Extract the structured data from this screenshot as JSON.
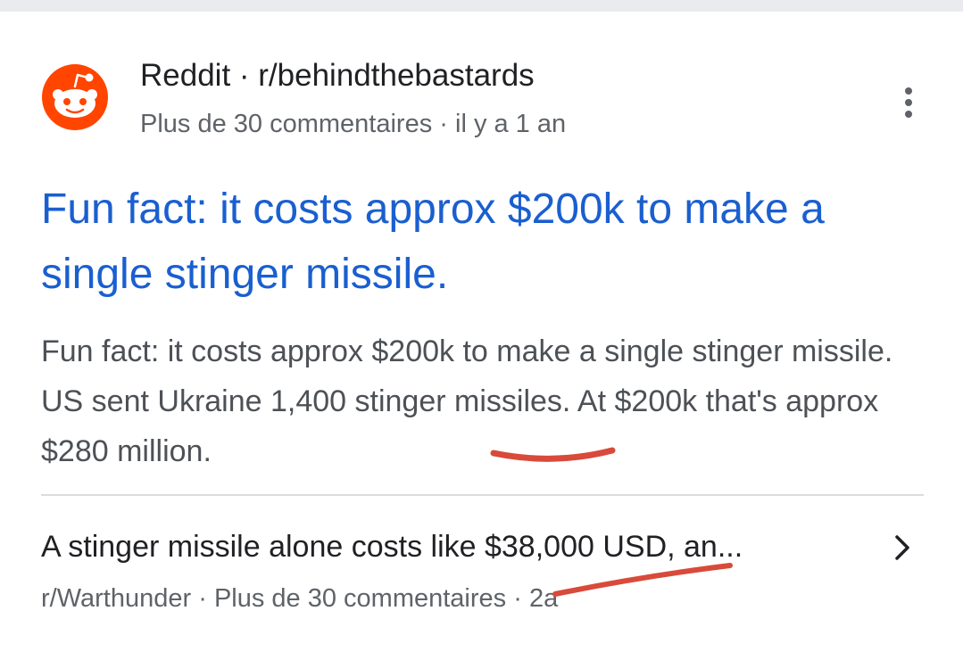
{
  "result": {
    "site_name": "Reddit",
    "separator": " · ",
    "subreddit": "r/behindthebastards",
    "comments": "Plus de 30 commentaires",
    "age": "il y a 1 an",
    "title": "Fun fact: it costs approx $200k to make a single stinger missile.",
    "snippet": "Fun fact: it costs approx $200k to make a single stinger missile. US sent Ukraine 1,400 stinger missiles. At $200k that's approx $280 million.",
    "logo_icon": "reddit-snoo-icon",
    "menu_icon": "more-vert-icon"
  },
  "related": {
    "title": "A stinger missile alone costs like $38,000 USD, an...",
    "subreddit": "r/Warthunder",
    "comments": "Plus de 30 commentaires",
    "age": "2a",
    "chevron_icon": "chevron-right-icon"
  },
  "colors": {
    "link_blue": "#1a5fd0",
    "reddit_orange": "#ff4500",
    "annotation_red": "#d94a3a"
  }
}
